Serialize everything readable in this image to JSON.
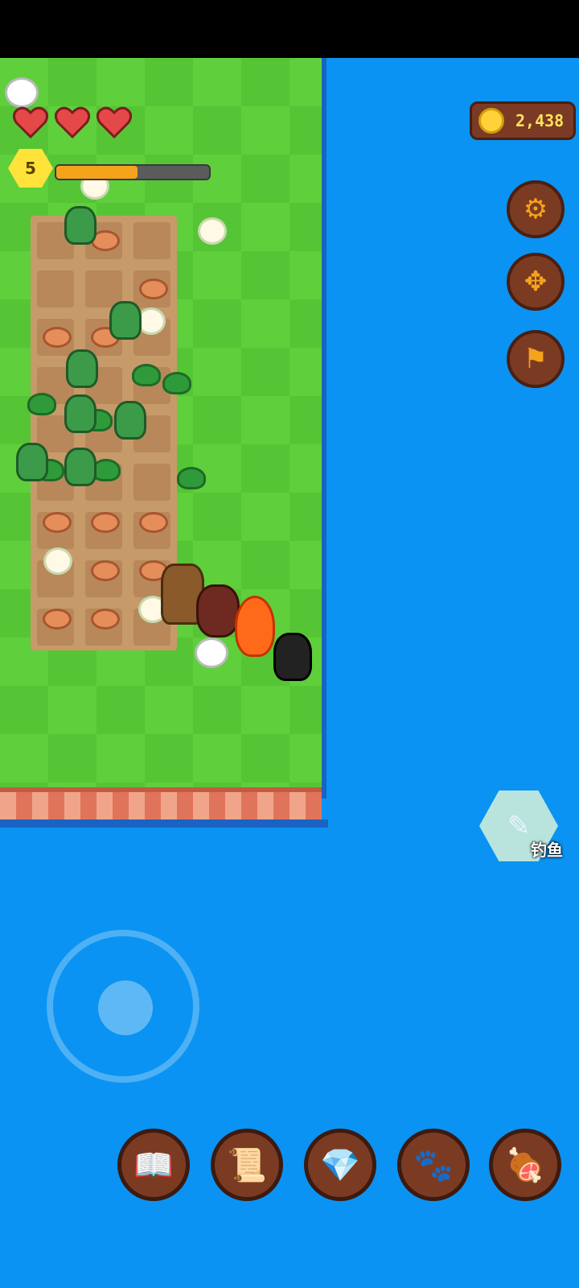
{
  "hud": {
    "hearts": 3,
    "level": "5",
    "xp_fraction": 0.53,
    "coins": "2,438"
  },
  "side_buttons": [
    {
      "icon": "gear-icon"
    },
    {
      "icon": "move-arrows-icon"
    },
    {
      "icon": "flag-icon"
    }
  ],
  "actions": {
    "fishing_label": "钓鱼"
  },
  "bottom_bar": [
    {
      "icon": "book-icon"
    },
    {
      "icon": "map-scroll-icon"
    },
    {
      "icon": "gem-coin-icon"
    },
    {
      "icon": "paw-icon"
    },
    {
      "icon": "meat-icon"
    }
  ],
  "colors": {
    "ocean": "#0a93f2",
    "grass": "#5fcf3c",
    "accent": "#f5a31b",
    "button_brown": "#7b3b23"
  }
}
